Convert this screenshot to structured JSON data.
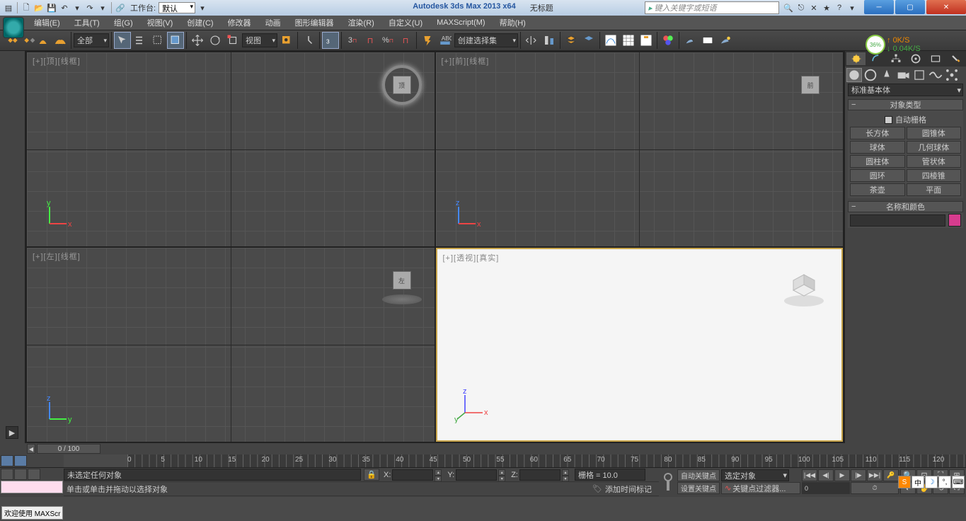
{
  "title": {
    "app": "Autodesk 3ds Max  2013 x64",
    "doc": "无标题",
    "workspace_label": "工作台:",
    "workspace_value": "默认",
    "search_placeholder": "键入关键字或短语"
  },
  "menu": [
    "编辑(E)",
    "工具(T)",
    "组(G)",
    "视图(V)",
    "创建(C)",
    "修改器",
    "动画",
    "图形编辑器",
    "渲染(R)",
    "自定义(U)",
    "MAXScript(M)",
    "帮助(H)"
  ],
  "toolbar": {
    "filter": "全部",
    "refcoord": "视图",
    "selset": "创建选择集"
  },
  "viewports": {
    "top": "[+][顶][线框]",
    "front": "[+][前][线框]",
    "left": "[+][左][线框]",
    "persp": "[+][透视][真实]"
  },
  "panel": {
    "dd": "标准基本体",
    "rollout1": "对象类型",
    "autogrid": "自动栅格",
    "prims": [
      "长方体",
      "圆锥体",
      "球体",
      "几何球体",
      "圆柱体",
      "管状体",
      "圆环",
      "四棱锥",
      "茶壶",
      "平面"
    ],
    "rollout2": "名称和颜色"
  },
  "timeline": {
    "slider": "0 / 100",
    "ticks": [
      0,
      5,
      10,
      15,
      20,
      25,
      30,
      35,
      40,
      45,
      50,
      55,
      60,
      65,
      70,
      75,
      80,
      85,
      90,
      95,
      100,
      105,
      110,
      115,
      120
    ]
  },
  "status": {
    "nosel": "未选定任何对象",
    "prompt": "单击或单击并拖动以选择对象",
    "x": "X:",
    "y": "Y:",
    "z": "Z:",
    "grid": "栅格 = 10.0",
    "addtag": "添加时间标记",
    "autokey": "自动关键点",
    "setkey": "设置关键点",
    "seldd": "选定对象",
    "keyfilter": "关键点过滤器..."
  },
  "netmon": {
    "pct": "36%",
    "up": "0K/S",
    "dn": "0.04K/S"
  },
  "maxscr": "欢迎使用  MAXScr",
  "ime": [
    "S",
    "中",
    "☽",
    "°,"
  ]
}
